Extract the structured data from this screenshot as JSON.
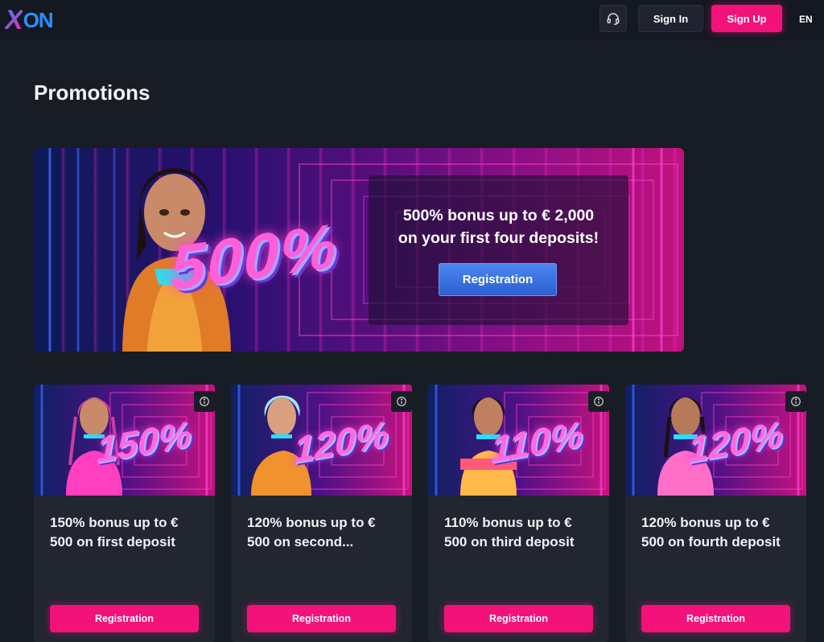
{
  "header": {
    "logo_x": "X",
    "logo_on": "ON",
    "signin_label": "Sign In",
    "signup_label": "Sign Up",
    "language": "EN"
  },
  "page": {
    "title": "Promotions"
  },
  "hero": {
    "badge": "500%",
    "headline_line1": "500% bonus up to € 2,000",
    "headline_line2": "on your first four deposits!",
    "button_label": "Registration"
  },
  "cards": [
    {
      "badge": "150%",
      "text": "150% bonus up to € 500 on first deposit",
      "button_label": "Registration"
    },
    {
      "badge": "120%",
      "text": "120% bonus up to € 500 on second...",
      "button_label": "Registration"
    },
    {
      "badge": "110%",
      "text": "110% bonus up to € 500 on third deposit",
      "button_label": "Registration"
    },
    {
      "badge": "120%",
      "text": "120% bonus up to € 500 on fourth deposit",
      "button_label": "Registration"
    }
  ],
  "colors": {
    "background": "#181c25",
    "header": "#141821",
    "accent_pink": "#f2127a",
    "accent_blue": "#2d8dff",
    "card": "#212631"
  },
  "icons": {
    "support": "headset-icon",
    "info": "info-icon"
  }
}
